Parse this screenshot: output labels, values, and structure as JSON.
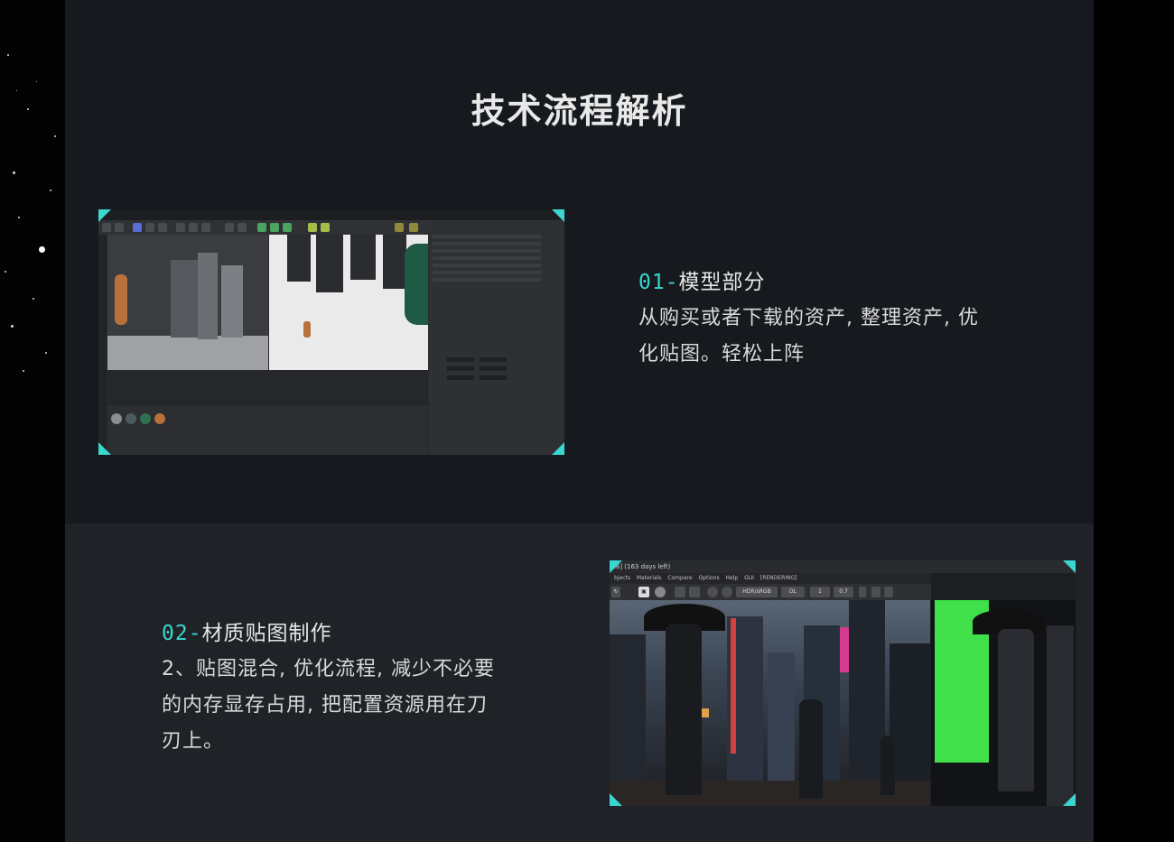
{
  "header": {
    "title": "技术流程解析"
  },
  "sections": [
    {
      "number": "01-",
      "title": "模型部分",
      "body_line1": "从购买或者下载的资产, 整理资产, 优",
      "body_line2": "化贴图。轻松上阵",
      "image": "cinema4d-modeling-screenshot"
    },
    {
      "number": "02-",
      "title": "材质贴图制作",
      "body_line1": "2、贴图混合, 优化流程, 减少不必要",
      "body_line2": "的内存显存占用, 把配置资源用在刀",
      "body_line3": "刃上。",
      "image": "octane-render-screenshot"
    }
  ],
  "render_window": {
    "title": "R6] (163 days left)",
    "menu": [
      "bjects",
      "Materials",
      "Compare",
      "Options",
      "Help",
      "GUI",
      "[RENDERING]"
    ],
    "color_space": "HDR/sRGB",
    "kernel": "DL",
    "value_a": "1",
    "value_b": "0.7"
  },
  "colors": {
    "accent": "#3ad6cf",
    "panel_top": "#16191d",
    "panel_bottom": "#1f2327",
    "text": "#e6e6e6"
  }
}
